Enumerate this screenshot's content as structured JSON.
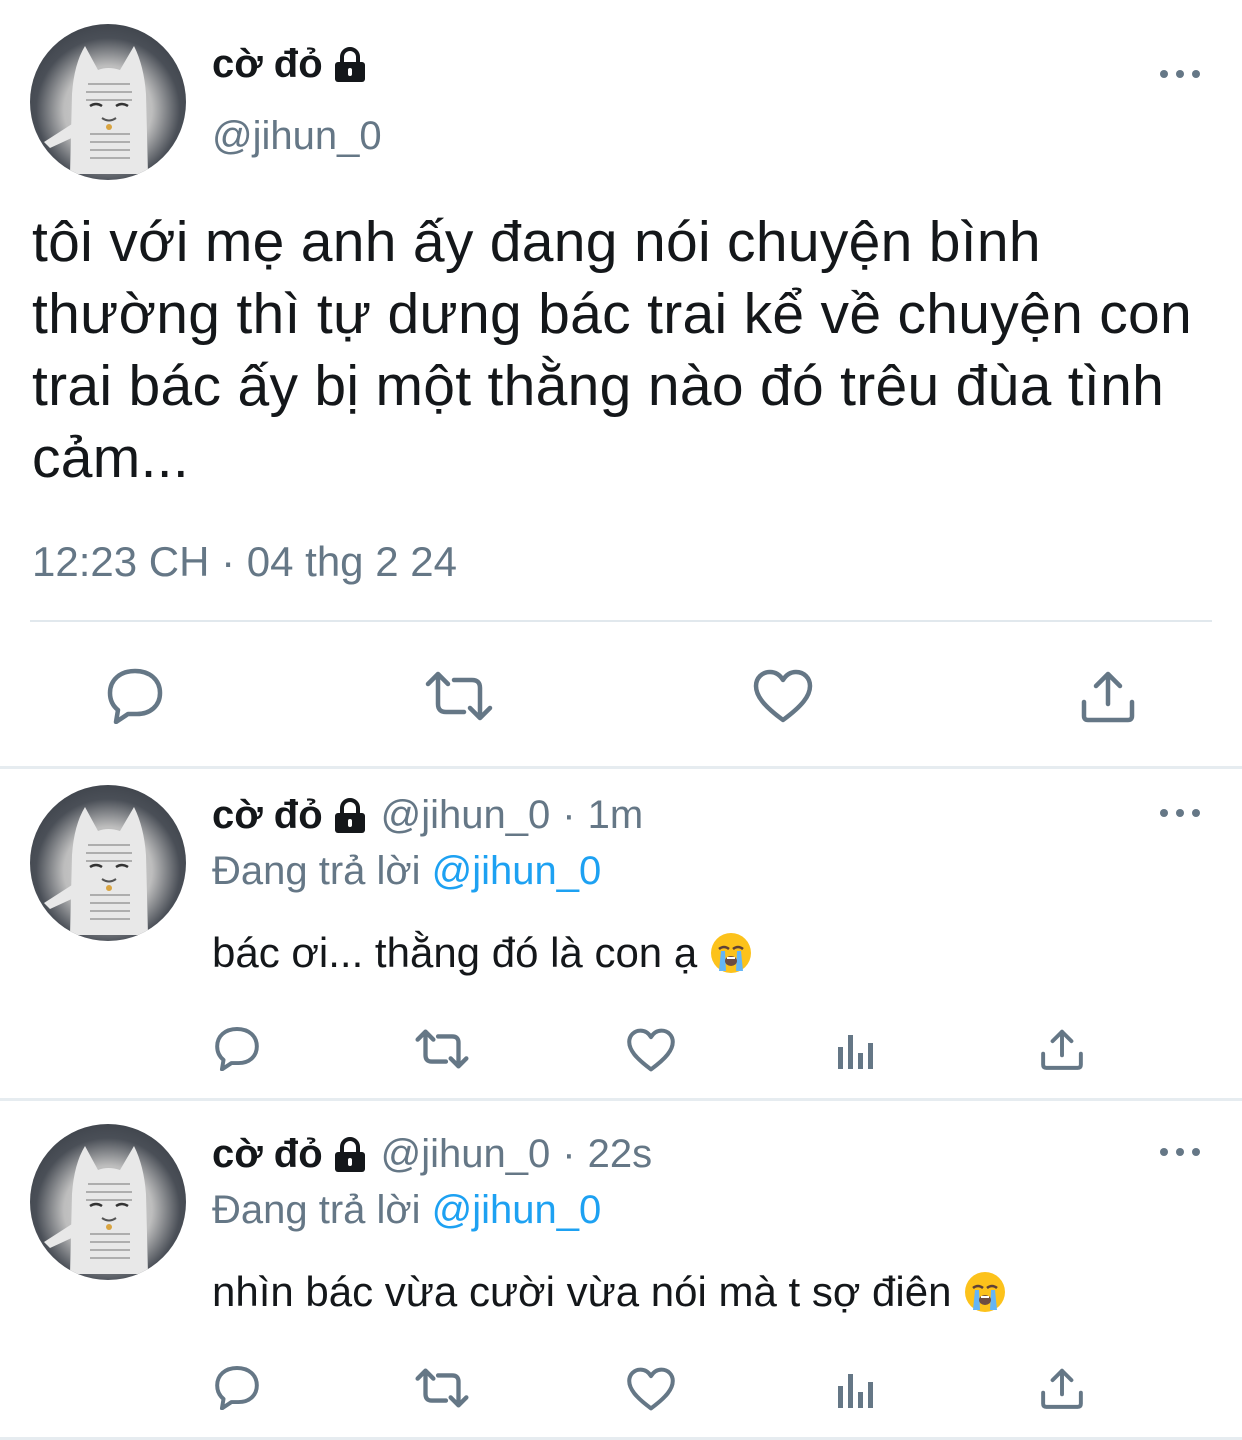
{
  "main_tweet": {
    "author_name": "cờ đỏ",
    "handle": "@jihun_0",
    "text": "tôi với mẹ anh ấy đang nói chuyện bình thường thì tự dưng bác trai kể về chuyện con trai bác ấy bị một thằng nào đó trêu đùa tình cảm...",
    "timestamp": "12:23 CH · 04 thg 2 24",
    "icons": [
      "lock-icon",
      "more-icon",
      "reply-icon",
      "retweet-icon",
      "like-icon",
      "share-icon"
    ]
  },
  "replies": [
    {
      "author_name": "cờ đỏ",
      "handle": "@jihun_0",
      "separator": "·",
      "time": "1m",
      "replying_prefix": "Đang trả lời",
      "replying_to": "@jihun_0",
      "text": "bác ơi... thằng đó là con ạ",
      "emoji": "loudly-crying-face-icon",
      "icons": [
        "reply-icon",
        "retweet-icon",
        "like-icon",
        "analytics-icon",
        "share-icon"
      ]
    },
    {
      "author_name": "cờ đỏ",
      "handle": "@jihun_0",
      "separator": "·",
      "time": "22s",
      "replying_prefix": "Đang trả lời",
      "replying_to": "@jihun_0",
      "text": "nhìn bác vừa cười vừa nói mà t sợ điên",
      "emoji": "loudly-crying-face-icon",
      "icons": [
        "reply-icon",
        "retweet-icon",
        "like-icon",
        "analytics-icon",
        "share-icon"
      ]
    }
  ],
  "colors": {
    "text": "#14171a",
    "secondary": "#657786",
    "accent": "#1da1f2",
    "divider": "#e1e8ed"
  }
}
